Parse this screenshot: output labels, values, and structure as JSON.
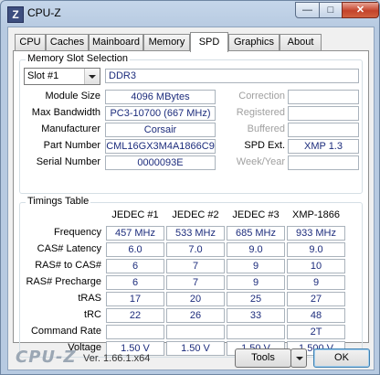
{
  "window": {
    "title": "CPU-Z",
    "icon_letter": "Z",
    "minimize_glyph": "—",
    "maximize_glyph": "□",
    "close_glyph": "✕"
  },
  "tabs": [
    {
      "label": "CPU"
    },
    {
      "label": "Caches"
    },
    {
      "label": "Mainboard"
    },
    {
      "label": "Memory"
    },
    {
      "label": "SPD",
      "active": true
    },
    {
      "label": "Graphics"
    },
    {
      "label": "About"
    }
  ],
  "memory_slot": {
    "group_title": "Memory Slot Selection",
    "slot_selected": "Slot #1",
    "type": "DDR3",
    "labels": {
      "module_size": "Module Size",
      "max_bandwidth": "Max Bandwidth",
      "manufacturer": "Manufacturer",
      "part_number": "Part Number",
      "serial_number": "Serial Number",
      "correction": "Correction",
      "registered": "Registered",
      "buffered": "Buffered",
      "spd_ext": "SPD Ext.",
      "week_year": "Week/Year"
    },
    "values": {
      "module_size": "4096 MBytes",
      "max_bandwidth": "PC3-10700 (667 MHz)",
      "manufacturer": "Corsair",
      "part_number": "CML16GX3M4A1866C9",
      "serial_number": "0000093E",
      "correction": "",
      "registered": "",
      "buffered": "",
      "spd_ext": "XMP 1.3",
      "week_year": ""
    }
  },
  "timings": {
    "group_title": "Timings Table",
    "columns": [
      "JEDEC #1",
      "JEDEC #2",
      "JEDEC #3",
      "XMP-1866"
    ],
    "rows": [
      {
        "label": "Frequency",
        "values": [
          "457 MHz",
          "533 MHz",
          "685 MHz",
          "933 MHz"
        ]
      },
      {
        "label": "CAS# Latency",
        "values": [
          "6.0",
          "7.0",
          "9.0",
          "9.0"
        ]
      },
      {
        "label": "RAS# to CAS#",
        "values": [
          "6",
          "7",
          "9",
          "10"
        ]
      },
      {
        "label": "RAS# Precharge",
        "values": [
          "6",
          "7",
          "9",
          "9"
        ]
      },
      {
        "label": "tRAS",
        "values": [
          "17",
          "20",
          "25",
          "27"
        ]
      },
      {
        "label": "tRC",
        "values": [
          "22",
          "26",
          "33",
          "48"
        ]
      },
      {
        "label": "Command Rate",
        "values": [
          "",
          "",
          "",
          "2T"
        ]
      },
      {
        "label": "Voltage",
        "values": [
          "1.50 V",
          "1.50 V",
          "1.50 V",
          "1.500 V"
        ]
      }
    ]
  },
  "footer": {
    "logo": "CPU-Z",
    "version": "Ver. 1.66.1.x64",
    "tools_label": "Tools",
    "ok_label": "OK"
  }
}
